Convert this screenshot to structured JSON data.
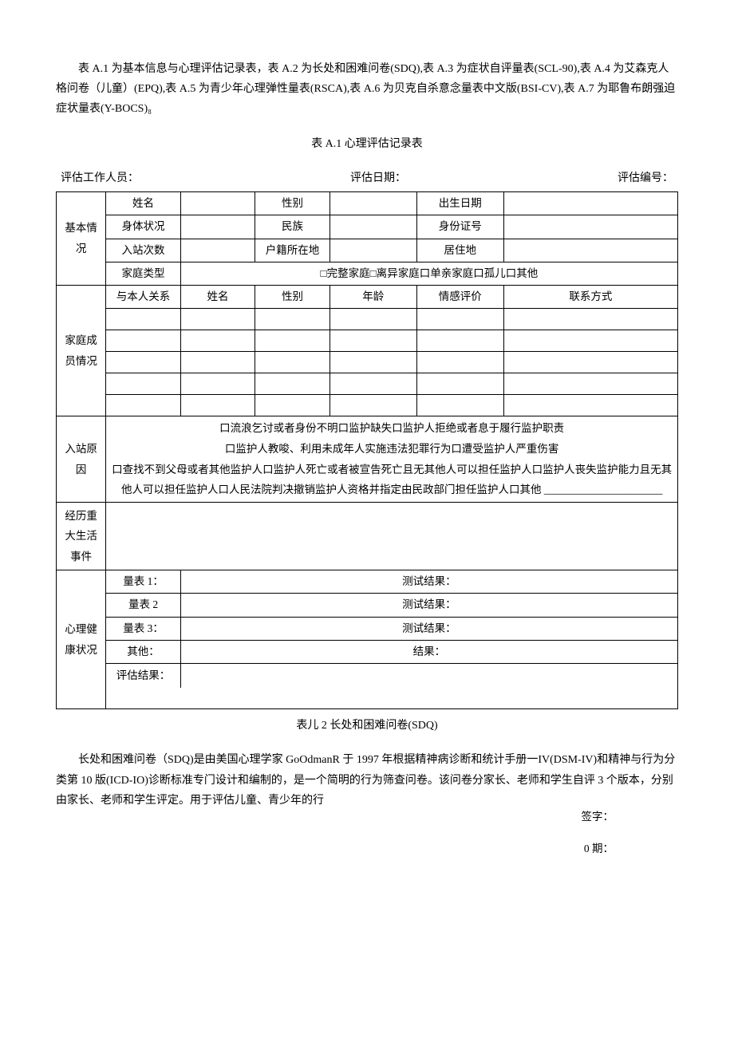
{
  "intro": "表 A.1 为基本信息与心理评估记录表，表 A.2 为长处和困难问卷(SDQ),表 A.3 为症状自评量表(SCL-90),表 A.4 为艾森克人格问卷（儿童）(EPQ),表 A.5 为青少年心理弹性量表(RSCA),表 A.6 为贝克自杀意念量表中文版(BSI-CV),表 A.7 为耶鲁布朗强迫症状量表(Y-BOCS)₈",
  "caption_a1": "表 A.1 心理评估记录表",
  "meta": {
    "staff_label": "评估工作人员：",
    "date_label": "评估日期：",
    "id_label": "评估编号："
  },
  "basic": {
    "group": "基本情况",
    "name": "姓名",
    "sex": "性别",
    "dob": "出生日期",
    "body": "身体状况",
    "ethnic": "民族",
    "idno": "身份证号",
    "visits": "入站次数",
    "hukou": "户籍所在地",
    "residence": "居住地",
    "family_type": "家庭类型",
    "family_opts": "□完整家庭□离异家庭口单亲家庭口孤儿口其他"
  },
  "family": {
    "group": "家庭成员情况",
    "rel": "与本人关系",
    "name": "姓名",
    "sex": "性别",
    "age": "年龄",
    "emotion": "情感评价",
    "contact": "联系方式"
  },
  "reason": {
    "group": "入站原因",
    "text": "口流浪乞讨或者身份不明口监护缺失口监护人拒绝或者息于履行监护职责\n口监护人教唆、利用未成年人实施违法犯罪行为口遭受监护人严重伤害\n口查找不到父母或者其他监护人口监护人死亡或者被宣告死亡且无其他人可以担任监护人口监护人丧失监护能力且无其他人可以担任监护人口人民法院判决撤销监护人资格并指定由民政部门担任监护人口其他 ______________________"
  },
  "events_group": "经历重大生活事件",
  "psych": {
    "group": "心理健康状况",
    "s1": "量表 1：",
    "s2": "量表 2",
    "s3": "量表 3：",
    "other": "其他：",
    "r": "测试结果：",
    "r_other": "结果：",
    "eval": "评估结果：",
    "sign": "签字：",
    "date": "0 期："
  },
  "caption_a2": "表儿 2 长处和困难问卷(SDQ)",
  "outro": "长处和困难问卷（SDQ)是由美国心理学家 GoOdmanR 于 1997 年根据精神病诊断和统计手册一IV(DSM-IV)和精神与行为分类第 10 版(ICD-IO)诊断标准专门设计和编制的，是一个简明的行为筛查问卷。该问卷分家长、老师和学生自评 3 个版本，分别由家长、老师和学生评定。用于评估儿童、青少年的行"
}
